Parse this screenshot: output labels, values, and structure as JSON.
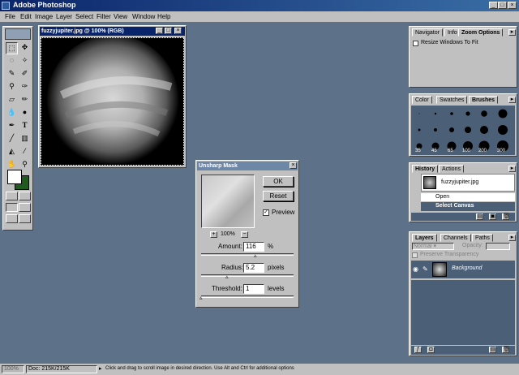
{
  "window": {
    "title": "Adobe Photoshop"
  },
  "menu": [
    "File",
    "Edit",
    "Image",
    "Layer",
    "Select",
    "Filter",
    "View",
    "Window",
    "Help"
  ],
  "image_window": {
    "title": "fuzzyjupiter.jpg @ 100% (RGB)"
  },
  "navigator_panel": {
    "tabs": [
      "Navigator",
      "Info",
      "Zoom Options"
    ],
    "option": "Resize Windows To Fit"
  },
  "brushes_panel": {
    "tabs": [
      "Color",
      "Swatches",
      "Brushes"
    ],
    "sizes": [
      "35",
      "45",
      "65",
      "100",
      "200",
      "300"
    ]
  },
  "history_panel": {
    "tabs": [
      "History",
      "Actions"
    ],
    "snapshot": "fuzzyjupiter.jpg",
    "items": [
      "Open",
      "Select Canvas"
    ]
  },
  "layers_panel": {
    "tabs": [
      "Layers",
      "Channels",
      "Paths"
    ],
    "blend_mode": "Normal",
    "opacity_label": "Opacity:",
    "preserve_label": "Preserve Transparency",
    "layer_name": "Background"
  },
  "dialog": {
    "title": "Unsharp Mask",
    "ok": "OK",
    "reset": "Reset",
    "preview": "Preview",
    "zoom": "100%",
    "amount_label": "Amount:",
    "amount_value": "116",
    "amount_unit": "%",
    "radius_label": "Radius:",
    "radius_value": "5.2",
    "radius_unit": "pixels",
    "threshold_label": "Threshold:",
    "threshold_value": "1",
    "threshold_unit": "levels"
  },
  "status": {
    "zoom": "100%",
    "doc": "Doc: 215K/215K",
    "hint": "Click and drag to scroll image in desired direction.  Use Alt and Ctrl for additional options"
  }
}
